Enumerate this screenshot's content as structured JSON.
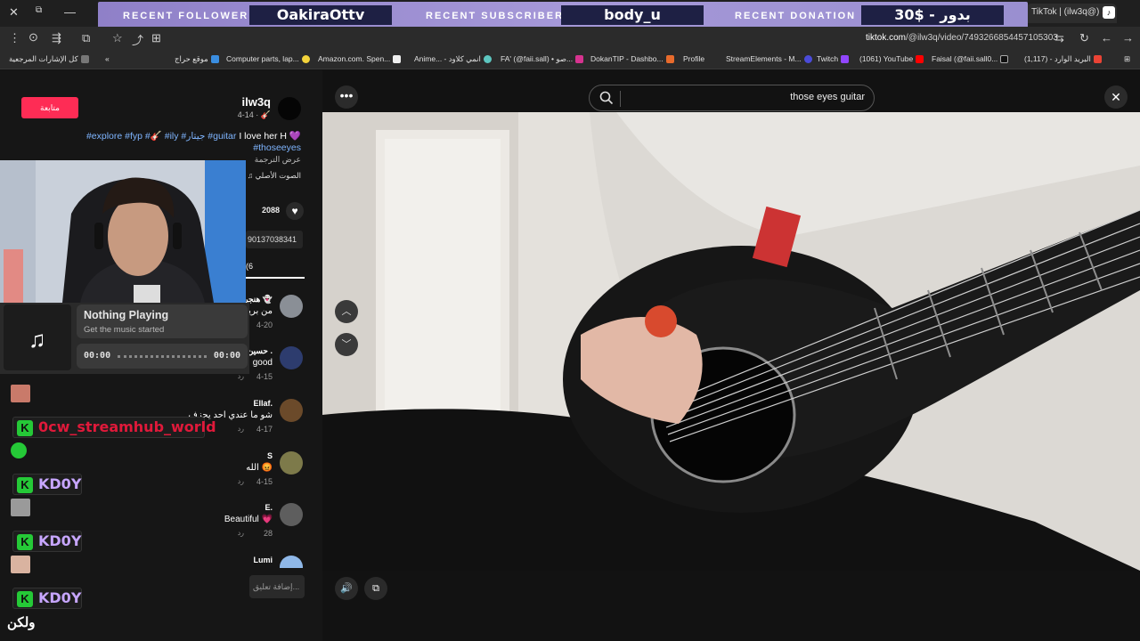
{
  "overlay": {
    "recent_follower_label": "RECENT FOLLOWER",
    "recent_follower_value": "OakiraOttv",
    "recent_subscriber_label": "RECENT SUBSCRIBER",
    "recent_subscriber_value": "body_u",
    "recent_donation_label": "RECENT DONATION",
    "recent_donation_value": "30$ - بدور"
  },
  "browser": {
    "active_tab_title": "TikTok | (ilw3q@) 🎸",
    "url_host": "tiktok.com",
    "url_path": "/@ilw3q/video/7493266854457105303"
  },
  "bookmarks": [
    {
      "label": "كل الإشارات المرجعية"
    },
    {
      "label": "موقع حراج"
    },
    {
      "label": "Computer parts, lap..."
    },
    {
      "label": "Amazon.com. Spen..."
    },
    {
      "label": "Anime... - انمي كلاود"
    },
    {
      "label": "FA' (@faii.sall) • صو..."
    },
    {
      "label": "DokanTIP - Dashbo..."
    },
    {
      "label": "Profile"
    },
    {
      "label": "StreamElements - M..."
    },
    {
      "label": "Twitch"
    },
    {
      "label": "(1061) YouTube"
    },
    {
      "label": "Faisal (@faii.sall0..."
    },
    {
      "label": "(1,117) - البريد الوارد"
    }
  ],
  "post": {
    "follow_label": "متابعة",
    "username": "ilw3q",
    "posted": "4-14 · 🎸",
    "caption_line1": "I love her H 💜",
    "caption_tags": "#explore #fyp #🎸 #ily #جيتار #guitar",
    "caption_line2": "#thoseeyes",
    "translate_label": "عرض الترجمة",
    "sound_label": "♫ الصوت الأصلي",
    "likes": "2088",
    "link_fragment": "90137038341",
    "comments_tab_fragment": "(6"
  },
  "comments": [
    {
      "name": "هنجر 👻",
      "text": "من برين",
      "date": "4-20",
      "reply": ""
    },
    {
      "name": "حسين .",
      "text": "good",
      "date": "4-15",
      "reply": "رد"
    },
    {
      "name": "Ellaf.",
      "text": "شو ما عندي احد يحزف",
      "date": "4-17",
      "reply": "رد"
    },
    {
      "name": "S",
      "text": "الله 😡",
      "date": "4-15",
      "reply": "رد"
    },
    {
      "name": "E.",
      "text": "Beautiful 💗",
      "date": "28",
      "reply": "رد"
    },
    {
      "name": "Lumi",
      "text": "",
      "date": "",
      "reply": ""
    }
  ],
  "comment_input_placeholder": "إضافة تعليق...",
  "video": {
    "search_query": "those eyes guitar"
  },
  "music_widget": {
    "title": "Nothing Playing",
    "subtitle": "Get the music started",
    "time_current": "00:00",
    "time_total": "00:00"
  },
  "chat": [
    {
      "user": "0cw_streamhub_world",
      "color": "#e0193a"
    },
    {
      "user": "KD0Y",
      "color": "#c7a6ff"
    },
    {
      "user": "KD0Y",
      "color": "#c7a6ff"
    },
    {
      "user": "KD0Y",
      "color": "#c7a6ff"
    }
  ],
  "chat_bottom_text": "ولكن",
  "colors": {
    "accent": "#fe2c55",
    "banner": "#a598d8",
    "banner_value_bg": "#1e2044",
    "chat_k": "#25c937"
  }
}
